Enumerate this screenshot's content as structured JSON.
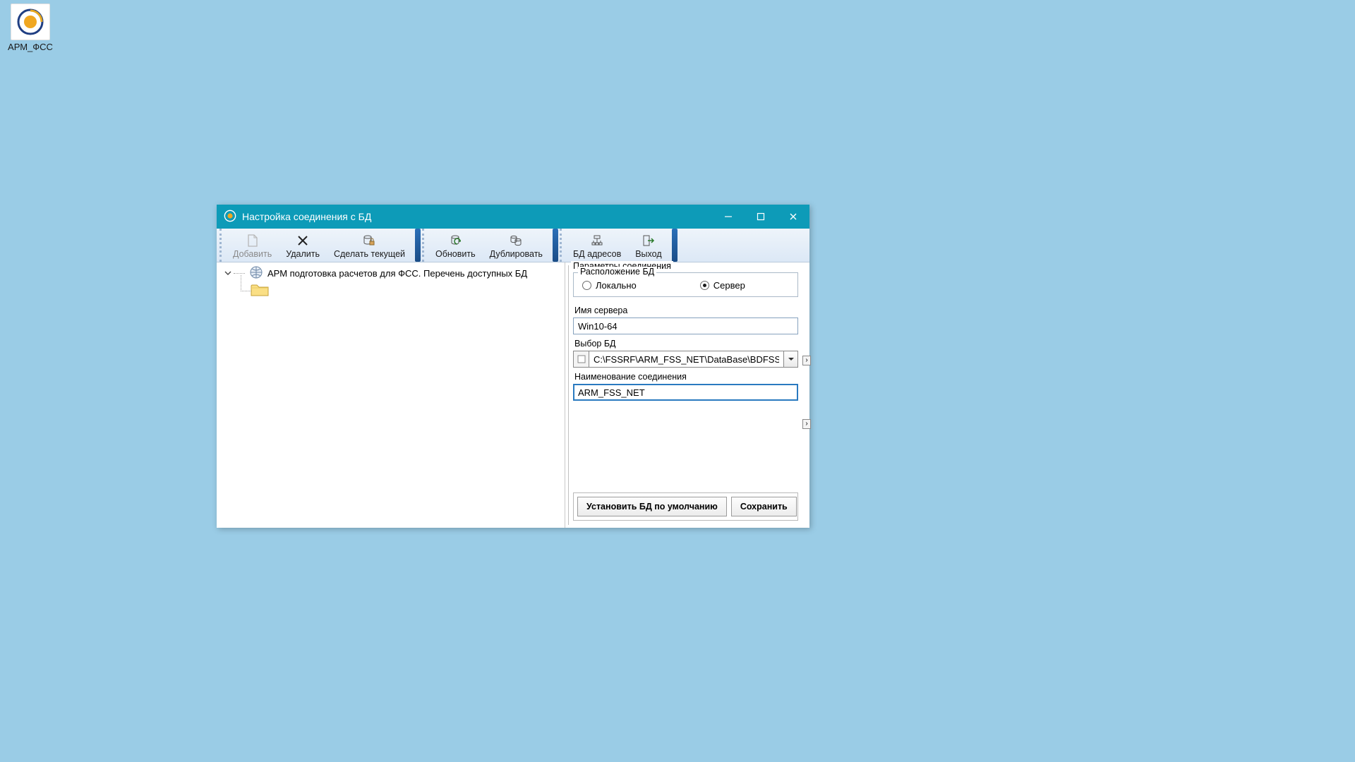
{
  "desktop": {
    "icon_label": "АРМ_ФСС"
  },
  "window": {
    "title": "Настройка соединения с БД"
  },
  "toolbar": {
    "add": "Добавить",
    "delete": "Удалить",
    "make_current": "Сделать текущей",
    "refresh": "Обновить",
    "duplicate": "Дублировать",
    "addr_db": "БД адресов",
    "exit": "Выход"
  },
  "tree": {
    "root_label": "АРМ подготовка расчетов для ФСС. Перечень доступных БД"
  },
  "props": {
    "legend": "Параметры соединения",
    "location_legend": "Расположение БД",
    "radio_local": "Локально",
    "radio_server": "Сервер",
    "server_name_label": "Имя сервера",
    "server_name_value": "Win10-64",
    "db_select_label": "Выбор БД",
    "db_path_value": "C:\\FSSRF\\ARM_FSS_NET\\DataBase\\BDFSS.FDB",
    "conn_name_label": "Наименование соединения",
    "conn_name_value": "ARM_FSS_NET",
    "btn_set_default": "Установить БД по умолчанию",
    "btn_save": "Сохранить"
  }
}
